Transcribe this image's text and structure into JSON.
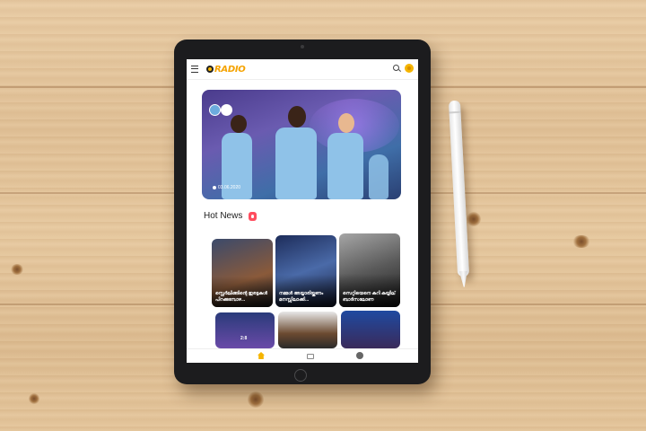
{
  "app": {
    "logo_text": "RADIO",
    "accent_color": "#f5a300",
    "icons": [
      "menu-icon",
      "search-icon",
      "coin-icon"
    ]
  },
  "hero": {
    "date": "03.06.2020"
  },
  "hot_news": {
    "title": "Hot News",
    "icon": "fire-icon",
    "cards": [
      {
        "caption": "സ്റ്റെർലിങ്ങിന്റെ ഇരട്ടകൾ പിറക്കുമ്പോഴ..."
      },
      {
        "caption": "നമ്മൾ അയ്യാരിയ്ക്കണം മനസ്സിലാക്കി..."
      },
      {
        "caption": "സെറ്റിയെനെ കുറി കയ്യില് ബാർസലോണ"
      },
      {
        "caption": "",
        "score": "2:8"
      },
      {
        "caption": ""
      },
      {
        "caption": ""
      }
    ]
  },
  "bottom_nav": {
    "items": [
      {
        "icon": "home-icon",
        "label": ""
      },
      {
        "icon": "radio-icon",
        "label": ""
      },
      {
        "icon": "info-icon",
        "label": ""
      }
    ]
  }
}
